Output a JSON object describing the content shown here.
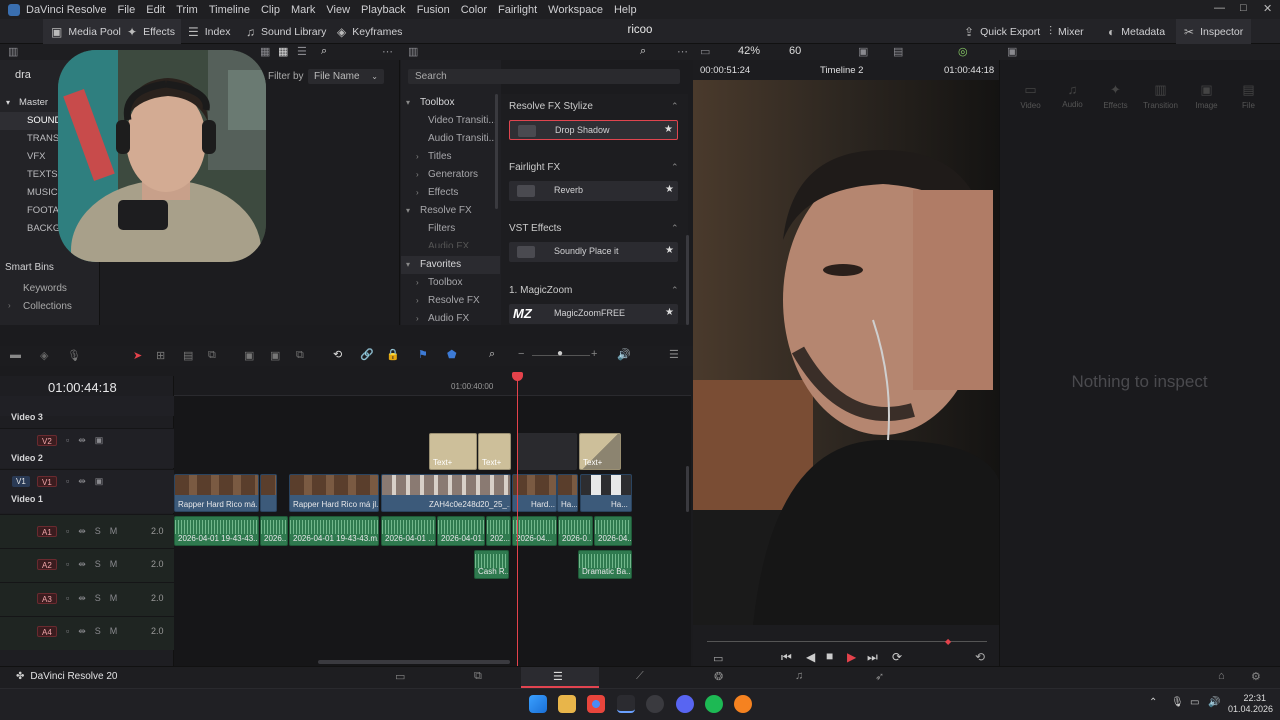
{
  "titlebar": {
    "app_name": "DaVinci Resolve",
    "menu": [
      "File",
      "Edit",
      "Trim",
      "Timeline",
      "Clip",
      "Mark",
      "View",
      "Playback",
      "Fusion",
      "Color",
      "Fairlight",
      "Workspace",
      "Help"
    ]
  },
  "toolbar": {
    "media_pool": "Media Pool",
    "effects": "Effects",
    "index": "Index",
    "sound_library": "Sound Library",
    "keyframes": "Keyframes",
    "project_title": "ricoo",
    "quick_export": "Quick Export",
    "mixer": "Mixer",
    "metadata": "Metadata",
    "inspector": "Inspector"
  },
  "media_pool": {
    "search_value": "dra",
    "filter_label": "Filter by",
    "filter_value": "File Name",
    "master": "Master",
    "bins": [
      "SOUND",
      "TRANSI",
      "VFX",
      "TEXTS",
      "MUSIC",
      "FOOTA",
      "BACKGR"
    ],
    "smart_bins": "Smart Bins",
    "smart_items": [
      "Keywords",
      "Collections"
    ]
  },
  "effects": {
    "search_placeholder": "Search",
    "tree": [
      "Toolbox",
      "Video Transiti...",
      "Audio Transiti...",
      "Titles",
      "Generators",
      "Effects",
      "Resolve FX",
      "Filters",
      "Audio FX"
    ],
    "favorites": "Favorites",
    "favorites_items": [
      "Toolbox",
      "Resolve FX",
      "Audio FX"
    ],
    "categories": [
      {
        "name": "Resolve FX Stylize",
        "item": "Drop Shadow"
      },
      {
        "name": "Fairlight FX",
        "item": "Reverb"
      },
      {
        "name": "VST Effects",
        "item": "Soundly Place it"
      },
      {
        "name": "1. MagicZoom",
        "item": "MagicZoomFREE"
      }
    ],
    "mz_logo": "MZ"
  },
  "viewer": {
    "zoom": "42%",
    "fps": "60",
    "timecode_left": "00:00:51:24",
    "timeline_name": "Timeline 2",
    "timecode_right": "01:00:44:18"
  },
  "inspector": {
    "tabs": [
      "Video",
      "Audio",
      "Effects",
      "Transition",
      "Image",
      "File"
    ],
    "empty_message": "Nothing to inspect"
  },
  "timeline": {
    "timecode": "01:00:44:18",
    "ruler_mark": "01:00:40:00",
    "video_tracks": [
      {
        "id": "V3",
        "name": "Video 3"
      },
      {
        "id": "V2",
        "name": "Video 2"
      },
      {
        "id": "V1",
        "name": "Video 1"
      }
    ],
    "audio_tracks": [
      {
        "id": "A1",
        "level": "2.0"
      },
      {
        "id": "A2",
        "level": "2.0"
      },
      {
        "id": "A3",
        "level": "2.0"
      },
      {
        "id": "A4",
        "level": "2.0"
      }
    ],
    "text_clips": [
      "Text+",
      "Text+",
      "Text+"
    ],
    "v1_clips": [
      "Rapper Hard Rico má...",
      "Rapper Hard Rico má jl...",
      "ZAH4c0e248d20_25_...",
      "Hard...",
      "Ha...",
      "Ha..."
    ],
    "a1_clips": [
      "2026-04-01 19-43-43...",
      "2026...",
      "2026-04-01 19-43-43.m...",
      "2026-04-01 ...",
      "2026-04-01...",
      "202...",
      "2026-04...",
      "2026-0...",
      "2026-04..."
    ],
    "a2_clips": [
      "Cash R...",
      "Dramatic Ba..."
    ]
  },
  "pagebar": {
    "brand": "DaVinci Resolve 20"
  },
  "taskbar": {
    "time": "22:31",
    "date": "01.04.2026"
  }
}
